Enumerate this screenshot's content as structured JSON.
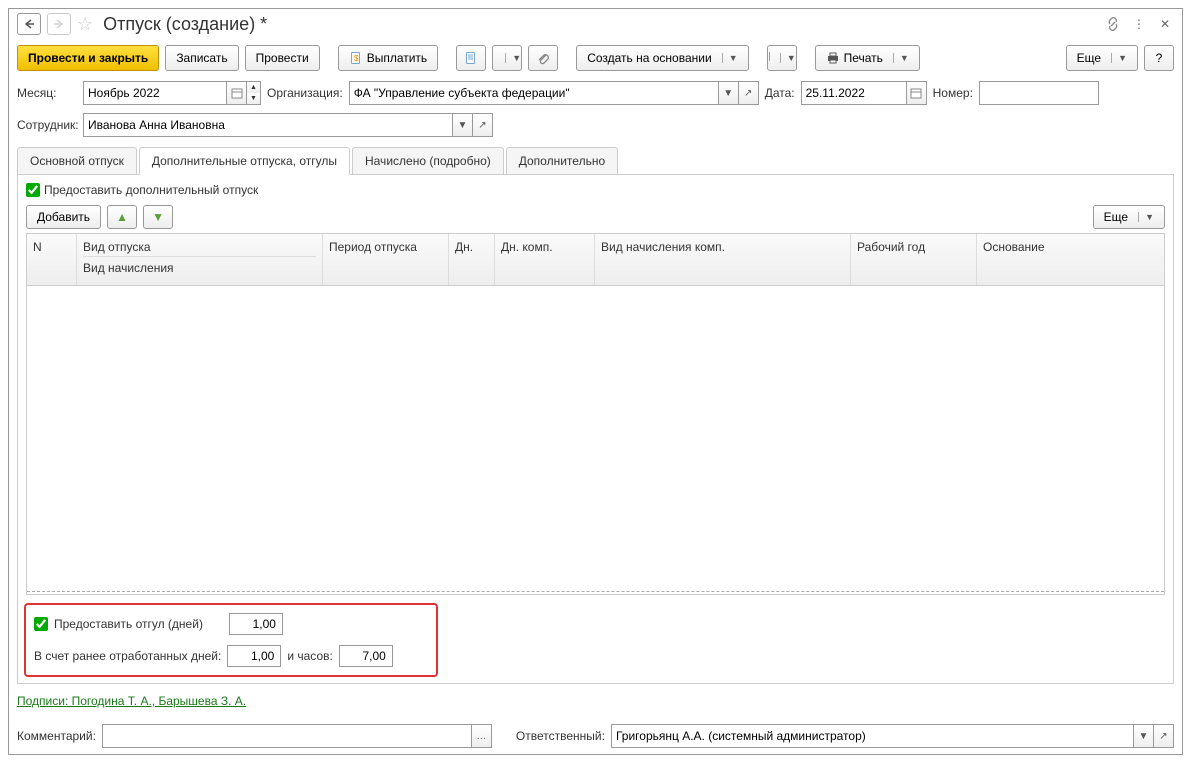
{
  "title": "Отпуск (создание) *",
  "toolbar": {
    "post_and_close": "Провести и закрыть",
    "save": "Записать",
    "post": "Провести",
    "pay": "Выплатить",
    "create_based_on": "Создать на основании",
    "print": "Печать",
    "more": "Еще"
  },
  "form": {
    "month_label": "Месяц:",
    "month_value": "Ноябрь 2022",
    "org_label": "Организация:",
    "org_value": "ФА \"Управление субъекта федерации\"",
    "date_label": "Дата:",
    "date_value": "25.11.2022",
    "number_label": "Номер:",
    "number_value": "",
    "employee_label": "Сотрудник:",
    "employee_value": "Иванова Анна Ивановна"
  },
  "tabs": {
    "main": "Основной отпуск",
    "additional": "Дополнительные отпуска, отгулы",
    "accrued": "Начислено (подробно)",
    "extra": "Дополнительно"
  },
  "additional_tab": {
    "provide_additional": "Предоставить дополнительный отпуск",
    "add_btn": "Добавить",
    "more_btn": "Еще",
    "columns": {
      "n": "N",
      "type": "Вид отпуска",
      "accrual_type": "Вид начисления",
      "period": "Период отпуска",
      "days": "Дн.",
      "days_comp": "Дн. комп.",
      "comp_type": "Вид начисления комп.",
      "work_year": "Рабочий год",
      "basis": "Основание"
    },
    "dayoff": {
      "provide_label": "Предоставить отгул (дней)",
      "provide_value": "1,00",
      "worked_days_label": "В счет ранее отработанных дней:",
      "worked_days_value": "1,00",
      "hours_label": "и часов:",
      "hours_value": "7,00"
    }
  },
  "signatures_link": "Подписи: Погодина Т. А., Барышева З. А.",
  "footer": {
    "comment_label": "Комментарий:",
    "comment_value": "",
    "responsible_label": "Ответственный:",
    "responsible_value": "Григорьянц А.А. (системный администратор)"
  }
}
